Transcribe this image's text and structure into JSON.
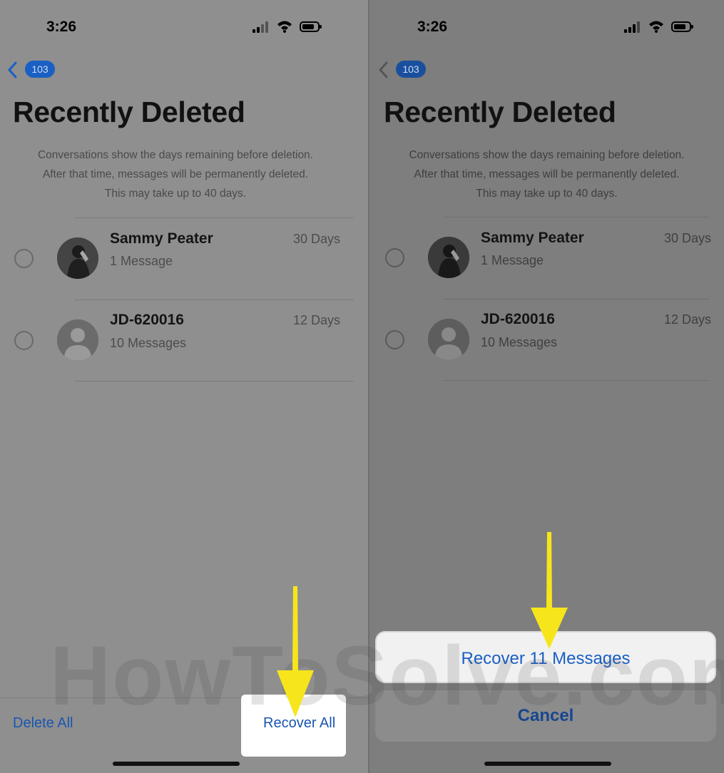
{
  "watermark": "HowToSolve.com",
  "left_panel": {
    "status": {
      "time": "3:26"
    },
    "nav": {
      "badge": "103"
    },
    "title": "Recently Deleted",
    "info": [
      "Conversations show the days remaining before deletion.",
      "After that time, messages will be permanently deleted.",
      "This may take up to 40 days."
    ],
    "conversations": [
      {
        "name": "Sammy Peater",
        "count": "1 Message",
        "days": "30 Days",
        "avatar": "photo"
      },
      {
        "name": "JD-620016",
        "count": "10 Messages",
        "days": "12 Days",
        "avatar": "default-person"
      }
    ],
    "toolbar": {
      "delete_all": "Delete All",
      "recover_all": "Recover All"
    }
  },
  "right_panel": {
    "status": {
      "time": "3:26"
    },
    "nav": {
      "badge": "103"
    },
    "title": "Recently Deleted",
    "info": [
      "Conversations show the days remaining before deletion.",
      "After that time, messages will be permanently deleted.",
      "This may take up to 40 days."
    ],
    "conversations": [
      {
        "name": "Sammy Peater",
        "count": "1 Message",
        "days": "30 Days",
        "avatar": "photo"
      },
      {
        "name": "JD-620016",
        "count": "10 Messages",
        "days": "12 Days",
        "avatar": "default-person"
      }
    ],
    "action_sheet": {
      "recover": "Recover 11 Messages",
      "cancel": "Cancel"
    }
  },
  "colors": {
    "accent": "#1a5fc4",
    "highlight_arrow": "#f7e51c",
    "dim_overlay": "#8f8f8f"
  }
}
